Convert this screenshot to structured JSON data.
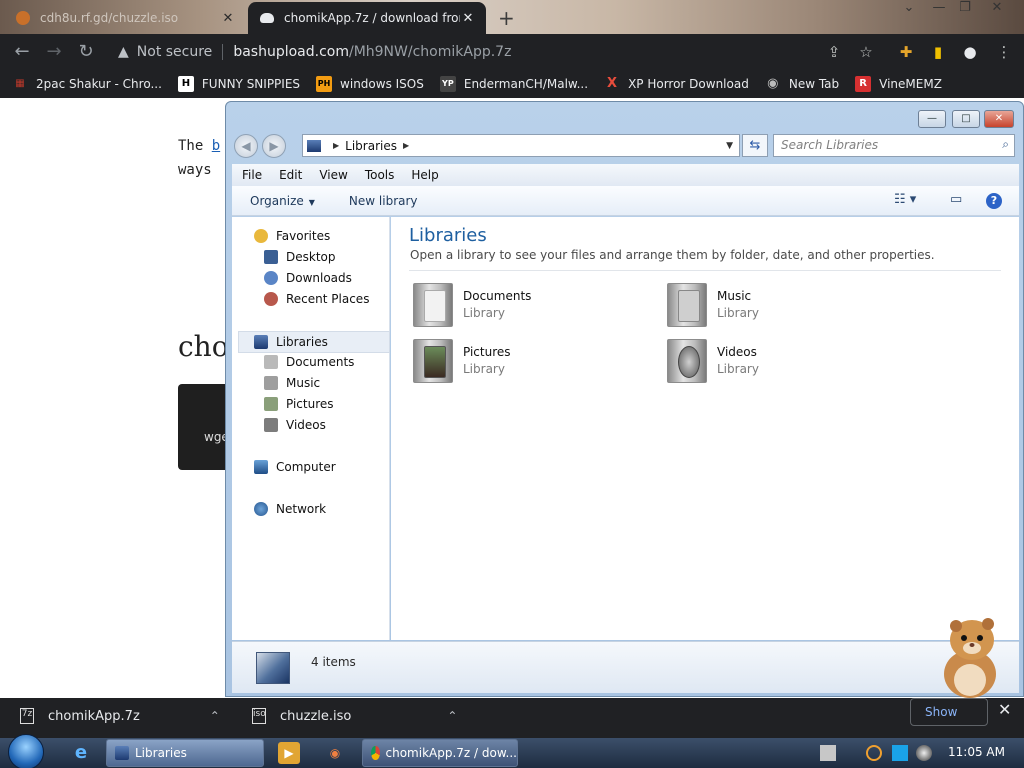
{
  "browser": {
    "tabs": [
      {
        "title": "cdh8u.rf.gd/chuzzle.iso",
        "close": "✕"
      },
      {
        "title": "chomikApp.7z / download from",
        "close": "✕"
      }
    ],
    "new_tab": "+",
    "window_controls": {
      "chevron": "⌄",
      "minimize": "—",
      "restore": "❐",
      "close": "✕"
    },
    "nav": {
      "back": "←",
      "forward": "→",
      "reload": "↻"
    },
    "omnibox": {
      "security_icon": "▲",
      "security_text": "Not secure",
      "host": "bashupload.com",
      "path": "/Mh9NW/chomikApp.7z"
    },
    "toolbar_icons": {
      "share": "⇪",
      "star": "☆",
      "extensions": "✚",
      "sidepanel": "▮",
      "profile": "●",
      "menu": "⋮"
    },
    "bookmarks": [
      {
        "label": "2pac Shakur - Chro...",
        "icon": "▦",
        "color": "#c0392b"
      },
      {
        "label": "FUNNY SNIPPIES",
        "icon": "H",
        "color": "#ffffff"
      },
      {
        "label": "windows ISOS",
        "icon": "PH",
        "color": "#f39c12"
      },
      {
        "label": "EndermanCH/Malw...",
        "icon": "YP",
        "color": "#444444"
      },
      {
        "label": "XP Horror Download",
        "icon": "X",
        "color": "#e74c3c"
      },
      {
        "label": "New Tab",
        "icon": "◉",
        "color": "#bbbbbb"
      },
      {
        "label": "VineMEMZ",
        "icon": "R",
        "color": "#d63031"
      }
    ]
  },
  "webpage": {
    "line1_prefix": "The",
    "line1_link": "b",
    "line2": "ways",
    "heading": "cho",
    "code": "wge"
  },
  "explorer": {
    "controls": {
      "minimize": "—",
      "maximize": "□",
      "close": "✕"
    },
    "back": "◀",
    "forward": "▶",
    "address": {
      "location": "Libraries",
      "arrow": "▶",
      "dropdown": "▼"
    },
    "refresh": "⇆",
    "search_placeholder": "Search Libraries",
    "search_icon": "⌕",
    "menu": [
      "File",
      "Edit",
      "View",
      "Tools",
      "Help"
    ],
    "commands": {
      "organize": "Organize",
      "dropdown": "▼",
      "new_library": "New library",
      "views": "☷ ▾",
      "preview": "▭",
      "help": "?"
    },
    "nav": {
      "favorites": {
        "label": "Favorites",
        "items": [
          "Desktop",
          "Downloads",
          "Recent Places"
        ]
      },
      "libraries": {
        "label": "Libraries",
        "items": [
          "Documents",
          "Music",
          "Pictures",
          "Videos"
        ]
      },
      "computer": "Computer",
      "network": "Network"
    },
    "content": {
      "title": "Libraries",
      "subtitle": "Open a library to see your files and arrange them by folder, date, and other properties.",
      "libraries": [
        {
          "name": "Documents",
          "type": "Library",
          "accent": "#e8e8e8"
        },
        {
          "name": "Music",
          "type": "Library",
          "accent": "#c9c9c9"
        },
        {
          "name": "Pictures",
          "type": "Library",
          "accent": "#6b8c5a"
        },
        {
          "name": "Videos",
          "type": "Library",
          "accent": "#555555"
        }
      ]
    },
    "details": {
      "count": "4 items"
    }
  },
  "downloads": {
    "items": [
      {
        "name": "chomikApp.7z",
        "icon": "7z",
        "caret": "⌃"
      },
      {
        "name": "chuzzle.iso",
        "icon": "iso",
        "caret": "⌃"
      }
    ],
    "show_all": "Show",
    "close": "✕"
  },
  "taskbar": {
    "tasks": [
      {
        "label": "Libraries"
      },
      {
        "label": "chomikApp.7z / dow..."
      }
    ],
    "pins": {
      "ie": "e",
      "media": "▶",
      "paint": "◉"
    },
    "clock": "11:05 AM"
  }
}
